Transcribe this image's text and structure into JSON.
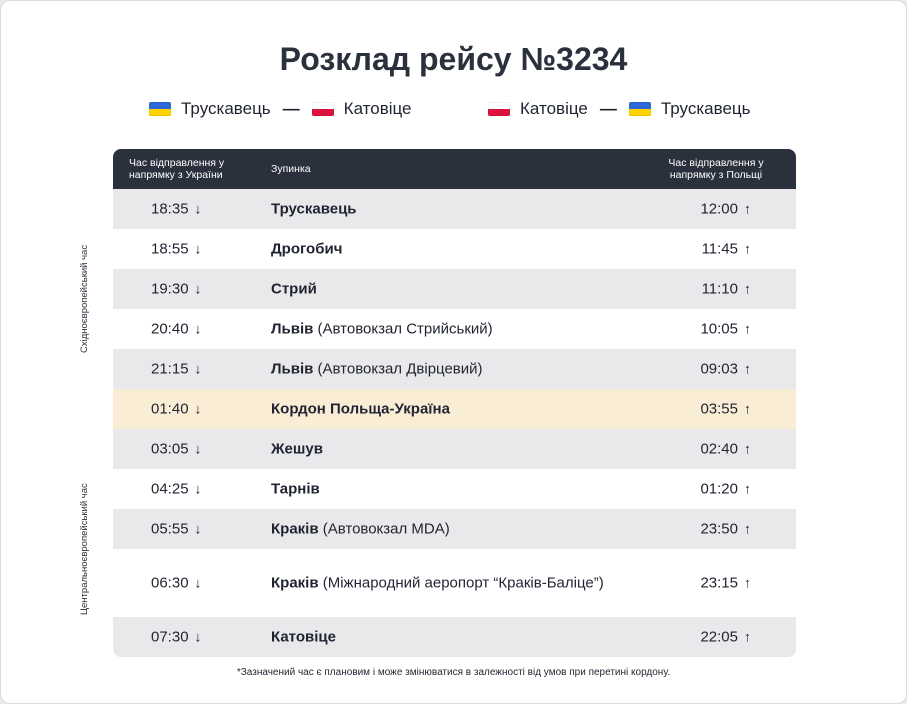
{
  "title": "Розклад рейсу №3234",
  "routes": [
    {
      "from": "Трускавець",
      "from_flag": "ukraine-flag",
      "separator": "—",
      "to": "Катовіце",
      "to_flag": "poland-flag"
    },
    {
      "from": "Катовіце",
      "from_flag": "poland-flag",
      "separator": "—",
      "to": "Трускавець",
      "to_flag": "ukraine-flag"
    }
  ],
  "table": {
    "headers": {
      "departure_ua": "Час відправлення у напрямку з України",
      "stop": "Зупинка",
      "departure_pl": "Час відправлення у напрямку з Польщі"
    },
    "rows": [
      {
        "dep": "18:35",
        "stop": "Трускавець",
        "detail": "",
        "arr": "12:00"
      },
      {
        "dep": "18:55",
        "stop": "Дрогобич",
        "detail": "",
        "arr": "11:45"
      },
      {
        "dep": "19:30",
        "stop": "Стрий",
        "detail": "",
        "arr": "11:10"
      },
      {
        "dep": "20:40",
        "stop": "Львів",
        "detail": "(Автовокзал Стрийський)",
        "arr": "10:05"
      },
      {
        "dep": "21:15",
        "stop": "Львів",
        "detail": "(Автовокзал Двірцевий)",
        "arr": "09:03"
      },
      {
        "dep": "01:40",
        "stop": "Кордон Польща-Україна",
        "detail": "",
        "arr": "03:55",
        "highlight": true
      },
      {
        "dep": "03:05",
        "stop": "Жешув",
        "detail": "",
        "arr": "02:40"
      },
      {
        "dep": "04:25",
        "stop": "Тарнів",
        "detail": "",
        "arr": "01:20"
      },
      {
        "dep": "05:55",
        "stop": "Краків",
        "detail": "(Автовокзал MDA)",
        "arr": "23:50"
      },
      {
        "dep": "06:30",
        "stop": "Краків",
        "detail": "(Міжнародний аеропорт “Краків-Баліце”)",
        "arr": "23:15",
        "tall": true
      },
      {
        "dep": "07:30",
        "stop": "Катовіце",
        "detail": "",
        "arr": "22:05"
      }
    ],
    "arrow_down": "↓",
    "arrow_up": "↑"
  },
  "side_labels": {
    "eastern": "Східноєвропейський час",
    "central": "Центральноєвропейський час"
  },
  "footnote": "*Зазначений час є плановим і може змінюватися в залежності від умов при перетині кордону.",
  "colors": {
    "header_bg": "#2b303d",
    "row_gray": "#e9e9ec",
    "row_white": "#ffffff",
    "border_highlight": "#faedd6",
    "flag_ua_blue": "#2f67d6",
    "flag_ua_yellow": "#ffd400",
    "flag_pl_red": "#dc143c"
  }
}
